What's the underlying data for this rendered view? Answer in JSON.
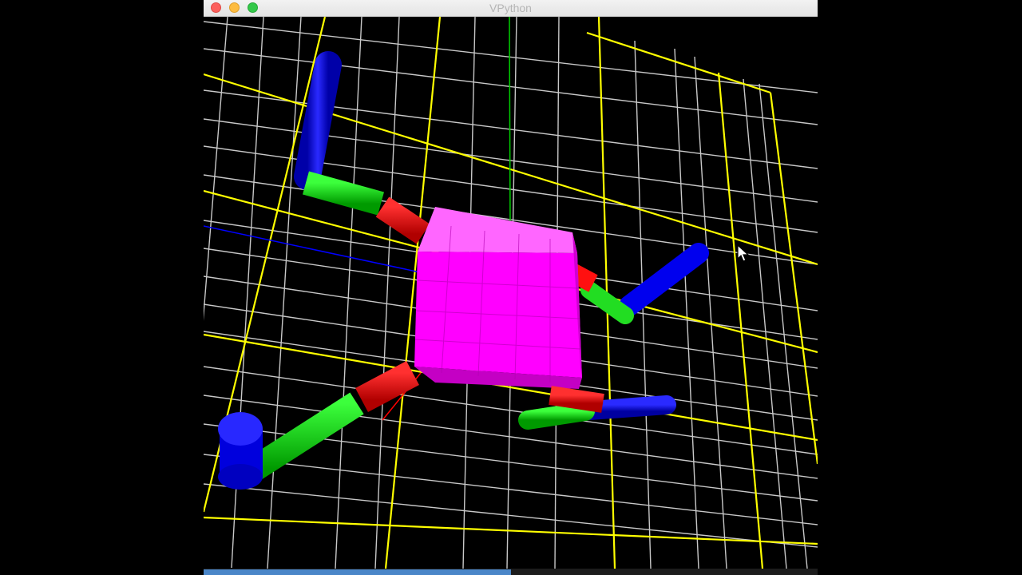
{
  "window": {
    "title": "VPython",
    "colors": {
      "background": "#000000",
      "grid_minor": "#c8c8c8",
      "grid_major": "#ffff00",
      "axis_y": "#00cc00",
      "axis_z": "#0000ff",
      "axis_x": "#ff0000",
      "body": "#ff00ff",
      "arm": "#ff0000",
      "leg": "#00dd00",
      "foot": "#0000ff"
    },
    "icons": [
      "close-icon",
      "minimize-icon",
      "maximize-icon",
      "mouse-pointer-icon"
    ]
  },
  "status": {
    "progress_fraction": 0.5
  }
}
